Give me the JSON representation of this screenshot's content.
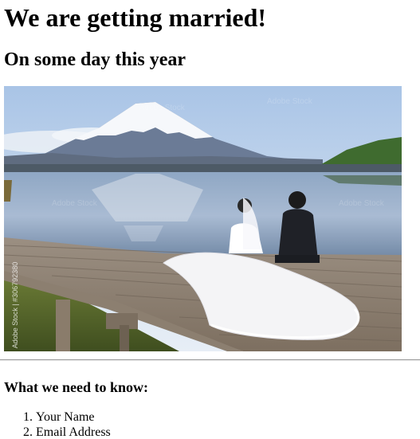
{
  "page": {
    "title": "We are getting married!",
    "subtitle": "On some day this year",
    "photo_watermark": "Adobe Stock | #306792380",
    "needs_heading": "What we need to know:",
    "needs_items": [
      "Your Name",
      "Email Address"
    ]
  },
  "colors": {
    "background": "#ffffff",
    "text": "#000000",
    "divider": "#999999"
  },
  "icons": {
    "photo": "wedding-couple-photo"
  }
}
